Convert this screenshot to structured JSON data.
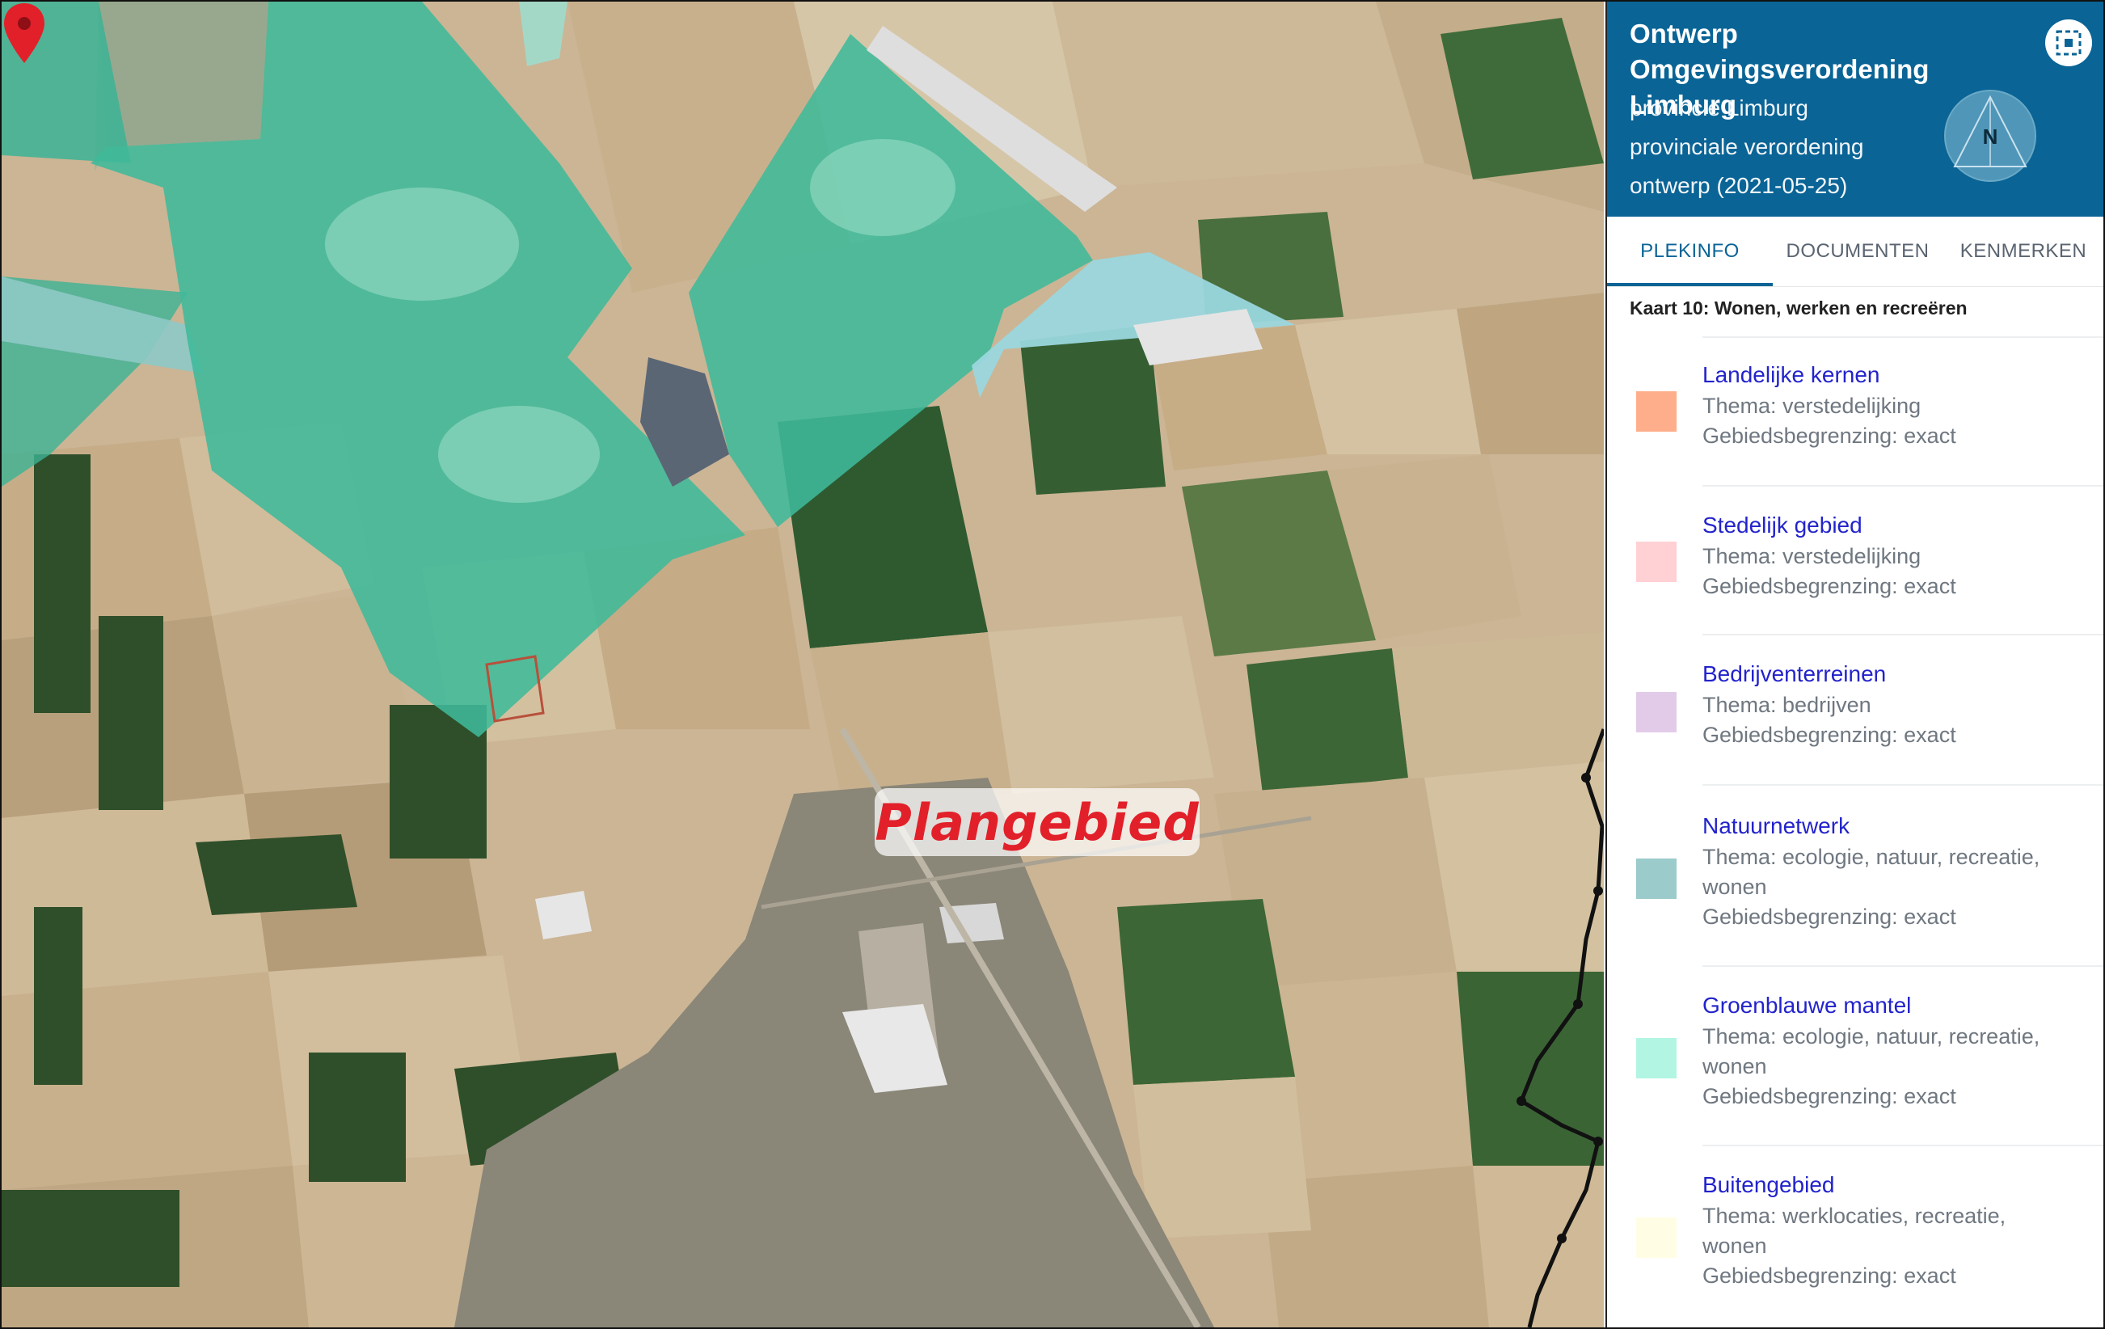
{
  "map": {
    "label": "Plangebied"
  },
  "panel": {
    "title": "Ontwerp Omgevingsverordening Limburg",
    "subtitle_lines": [
      "provincie Limburg",
      "provinciale verordening",
      "ontwerp (2021-05-25)"
    ],
    "compass_letter": "N",
    "colors": {
      "header": "#0a6496",
      "link": "#2323cc"
    },
    "tabs": [
      "PLEKINFO",
      "DOCUMENTEN",
      "KENMERKEN"
    ],
    "active_tab": "PLEKINFO",
    "section_title": "Kaart 10: Wonen, werken en recreëren",
    "items": [
      {
        "title": "Landelijke kernen",
        "lines": [
          "Thema: verstedelijking",
          "Gebiedsbegrenzing: exact"
        ],
        "color": "#ffae8c"
      },
      {
        "title": "Stedelijk gebied",
        "lines": [
          "Thema: verstedelijking",
          "Gebiedsbegrenzing: exact"
        ],
        "color": "#ffd0d4"
      },
      {
        "title": "Bedrijventerreinen",
        "lines": [
          "Thema: bedrijven",
          "Gebiedsbegrenzing: exact"
        ],
        "color": "#e2cbe8"
      },
      {
        "title": "Natuurnetwerk",
        "lines": [
          "Thema: ecologie, natuur, recreatie,",
          "wonen",
          "Gebiedsbegrenzing: exact"
        ],
        "color": "#9ccbcb"
      },
      {
        "title": "Groenblauwe mantel",
        "lines": [
          "Thema: ecologie, natuur, recreatie,",
          "wonen",
          "Gebiedsbegrenzing: exact"
        ],
        "color": "#b2f5e2"
      },
      {
        "title": "Buitengebied",
        "lines": [
          "Thema: werklocaties, recreatie,",
          "wonen",
          "Gebiedsbegrenzing: exact"
        ],
        "color": "#fffde4"
      }
    ]
  }
}
